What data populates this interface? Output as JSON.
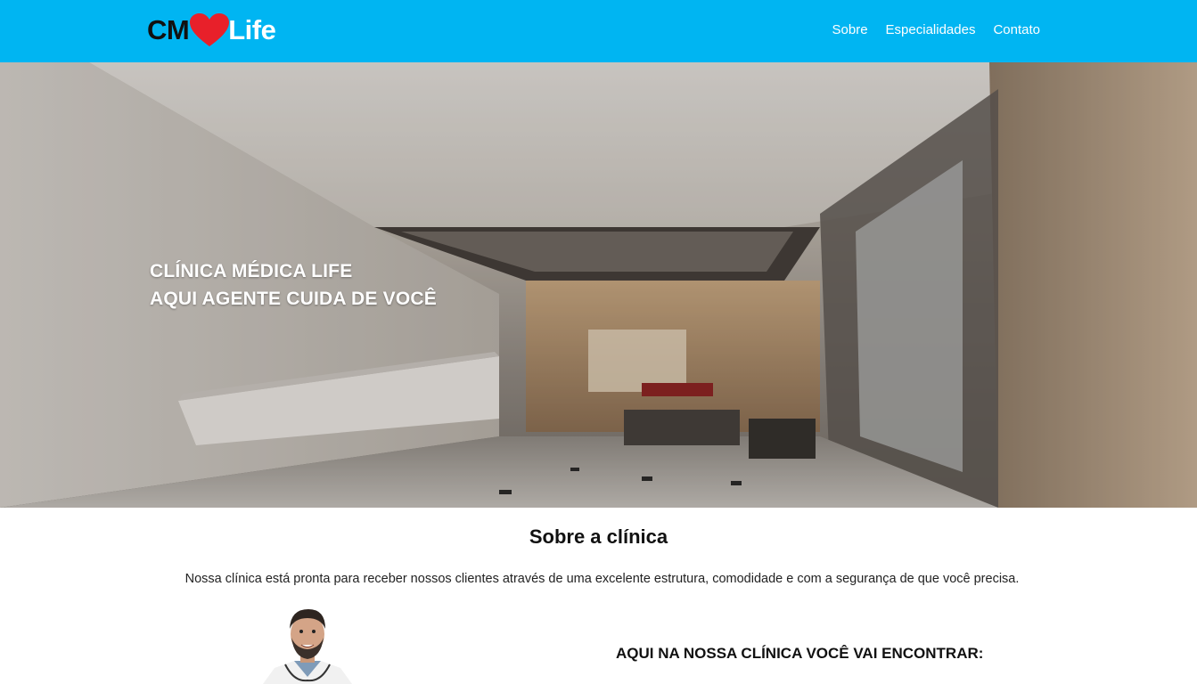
{
  "header": {
    "logo": {
      "part1": "CM",
      "part2": "Life",
      "heart_color": "#e8202a"
    },
    "nav": [
      {
        "label": "Sobre"
      },
      {
        "label": "Especialidades"
      },
      {
        "label": "Contato"
      }
    ],
    "background_color": "#00b5f2"
  },
  "hero": {
    "line1": "CLÍNICA MÉDICA LIFE",
    "line2": "AQUI AGENTE CUIDA DE VOCÊ",
    "image": "clinic-lobby-photo"
  },
  "about": {
    "title": "Sobre a clínica",
    "text": "Nossa clínica está pronta para receber nossos clientes através de uma excelente estrutura, comodidade e com a segurança de que você precisa.",
    "doctor_image": "doctor-photo",
    "find_title": "AQUI NA NOSSA CLÍNICA VOCÊ VAI ENCONTRAR:"
  }
}
